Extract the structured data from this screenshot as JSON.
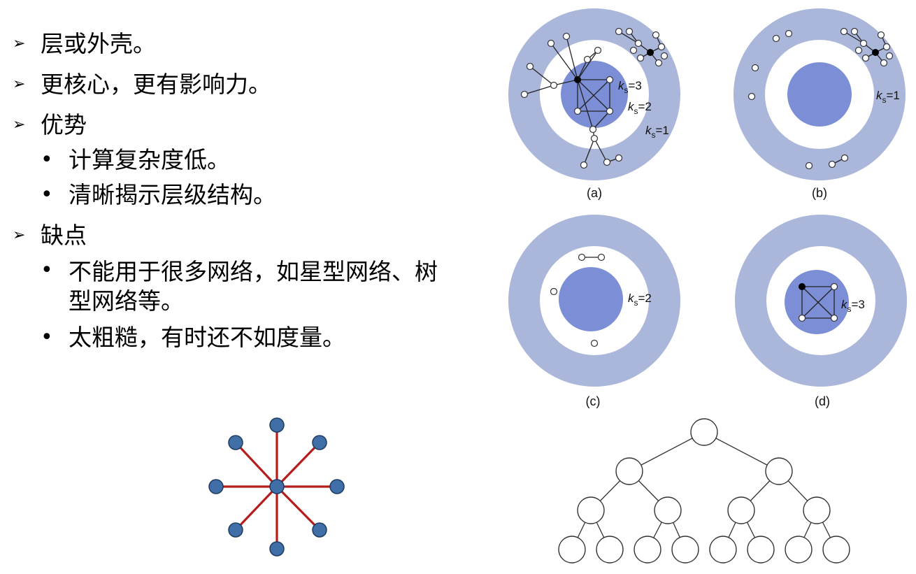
{
  "bullets": [
    {
      "text": "层或外壳。"
    },
    {
      "text": "更核心，更有影响力。"
    },
    {
      "text": "优势"
    },
    {
      "text": "计算复杂度低。"
    },
    {
      "text": "清晰揭示层级结构。"
    },
    {
      "text": "缺点"
    },
    {
      "text": "不能用于很多网络，如星型网络、树型网络等。"
    },
    {
      "text": "太粗糙，有时还不如度量。"
    }
  ],
  "figure": {
    "panel_labels": [
      "(a)",
      "(b)",
      "(c)",
      "(d)"
    ],
    "ks": {
      "k": "k",
      "s": "s",
      "v3": "=3",
      "v2": "=2",
      "v1": "=1"
    }
  },
  "colors": {
    "ring_outer": "#aab6da",
    "core": "#7b8ed6",
    "star_edge": "#b71c1c",
    "star_node": "#3f6fa6"
  }
}
